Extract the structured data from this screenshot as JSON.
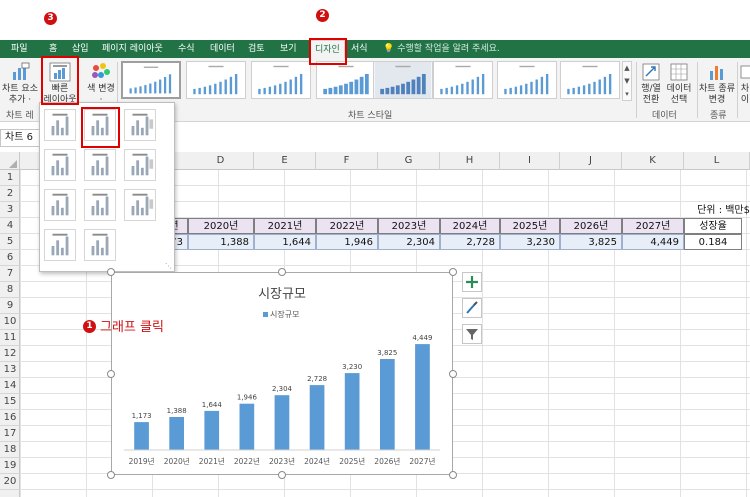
{
  "ribbon_tabs": [
    {
      "label": "파일"
    },
    {
      "label": "홈"
    },
    {
      "label": "삽입"
    },
    {
      "label": "페이지 레이아웃"
    },
    {
      "label": "수식"
    },
    {
      "label": "데이터"
    },
    {
      "label": "검토"
    },
    {
      "label": "보기"
    },
    {
      "label": "디자인"
    },
    {
      "label": "서식"
    }
  ],
  "tell_me": "수행할 작업을 알려 주세요.",
  "ribbon": {
    "add_element_line1": "차트 요소",
    "add_element_line2": "추가 ·",
    "quick_layout_line1": "빠른",
    "quick_layout_line2": "레이아웃 ·",
    "change_color_label": "색 변경",
    "change_color_caret": "·",
    "switch_row_col_line1": "행/열",
    "switch_row_col_line2": "전환",
    "select_data_line1": "데이터",
    "select_data_line2": "선택",
    "change_type_line1": "차트 종류",
    "change_type_line2": "변경",
    "move_chart_line1": "차",
    "move_chart_line2": "이",
    "group_chart_layout": "차트 레",
    "group_chart_styles": "차트 스타일",
    "group_data": "데이터",
    "group_type": "종류"
  },
  "name_box": "차트 6",
  "columns": [
    "D",
    "E",
    "F",
    "G",
    "H",
    "I",
    "J",
    "K",
    "L"
  ],
  "rows": [
    "1",
    "2",
    "3",
    "4",
    "5",
    "6",
    "7",
    "8",
    "9",
    "10",
    "11",
    "12",
    "13",
    "14",
    "15",
    "16",
    "17",
    "18",
    "19",
    "20"
  ],
  "sheet": {
    "unit_label": "단위 : 백만$",
    "year_headers": [
      "년",
      "2020년",
      "2021년",
      "2022년",
      "2023년",
      "2024년",
      "2025년",
      "2026년",
      "2027년"
    ],
    "growth_header": "성장율",
    "values": [
      "73",
      "1,388",
      "1,644",
      "1,946",
      "2,304",
      "2,728",
      "3,230",
      "3,825",
      "4,449"
    ],
    "growth_value": "0.184"
  },
  "steps": {
    "step1_num": "1",
    "step1_text": "그래프 클릭",
    "step2_num": "2",
    "step3_num": "3"
  },
  "colors": {
    "ribbon_green": "#217346",
    "bar_blue": "#5b9bd5",
    "step_red": "#d01010",
    "year_header_fill": "#ebe3f1",
    "value_fill": "#e8eef8"
  },
  "chart_data": {
    "type": "bar",
    "title": "시장규모",
    "legend": "시장규모",
    "legend_position": "top",
    "categories": [
      "2019년",
      "2020년",
      "2021년",
      "2022년",
      "2023년",
      "2024년",
      "2025년",
      "2026년",
      "2027년"
    ],
    "values": [
      1173,
      1388,
      1644,
      1946,
      2304,
      2728,
      3230,
      3825,
      4449
    ],
    "data_labels": [
      "1,173",
      "1,388",
      "1,644",
      "1,946",
      "2,304",
      "2,728",
      "3,230",
      "3,825",
      "4,449"
    ],
    "ylim": [
      0,
      5000
    ],
    "y_axis_visible": false,
    "grid": false
  },
  "icons": {
    "add_element": "chart-add-element-icon",
    "quick_layout": "quick-layout-icon",
    "change_colors": "palette-icon",
    "chart_elements": "plus-icon",
    "chart_styles": "brush-icon",
    "chart_filters": "filter-icon"
  }
}
